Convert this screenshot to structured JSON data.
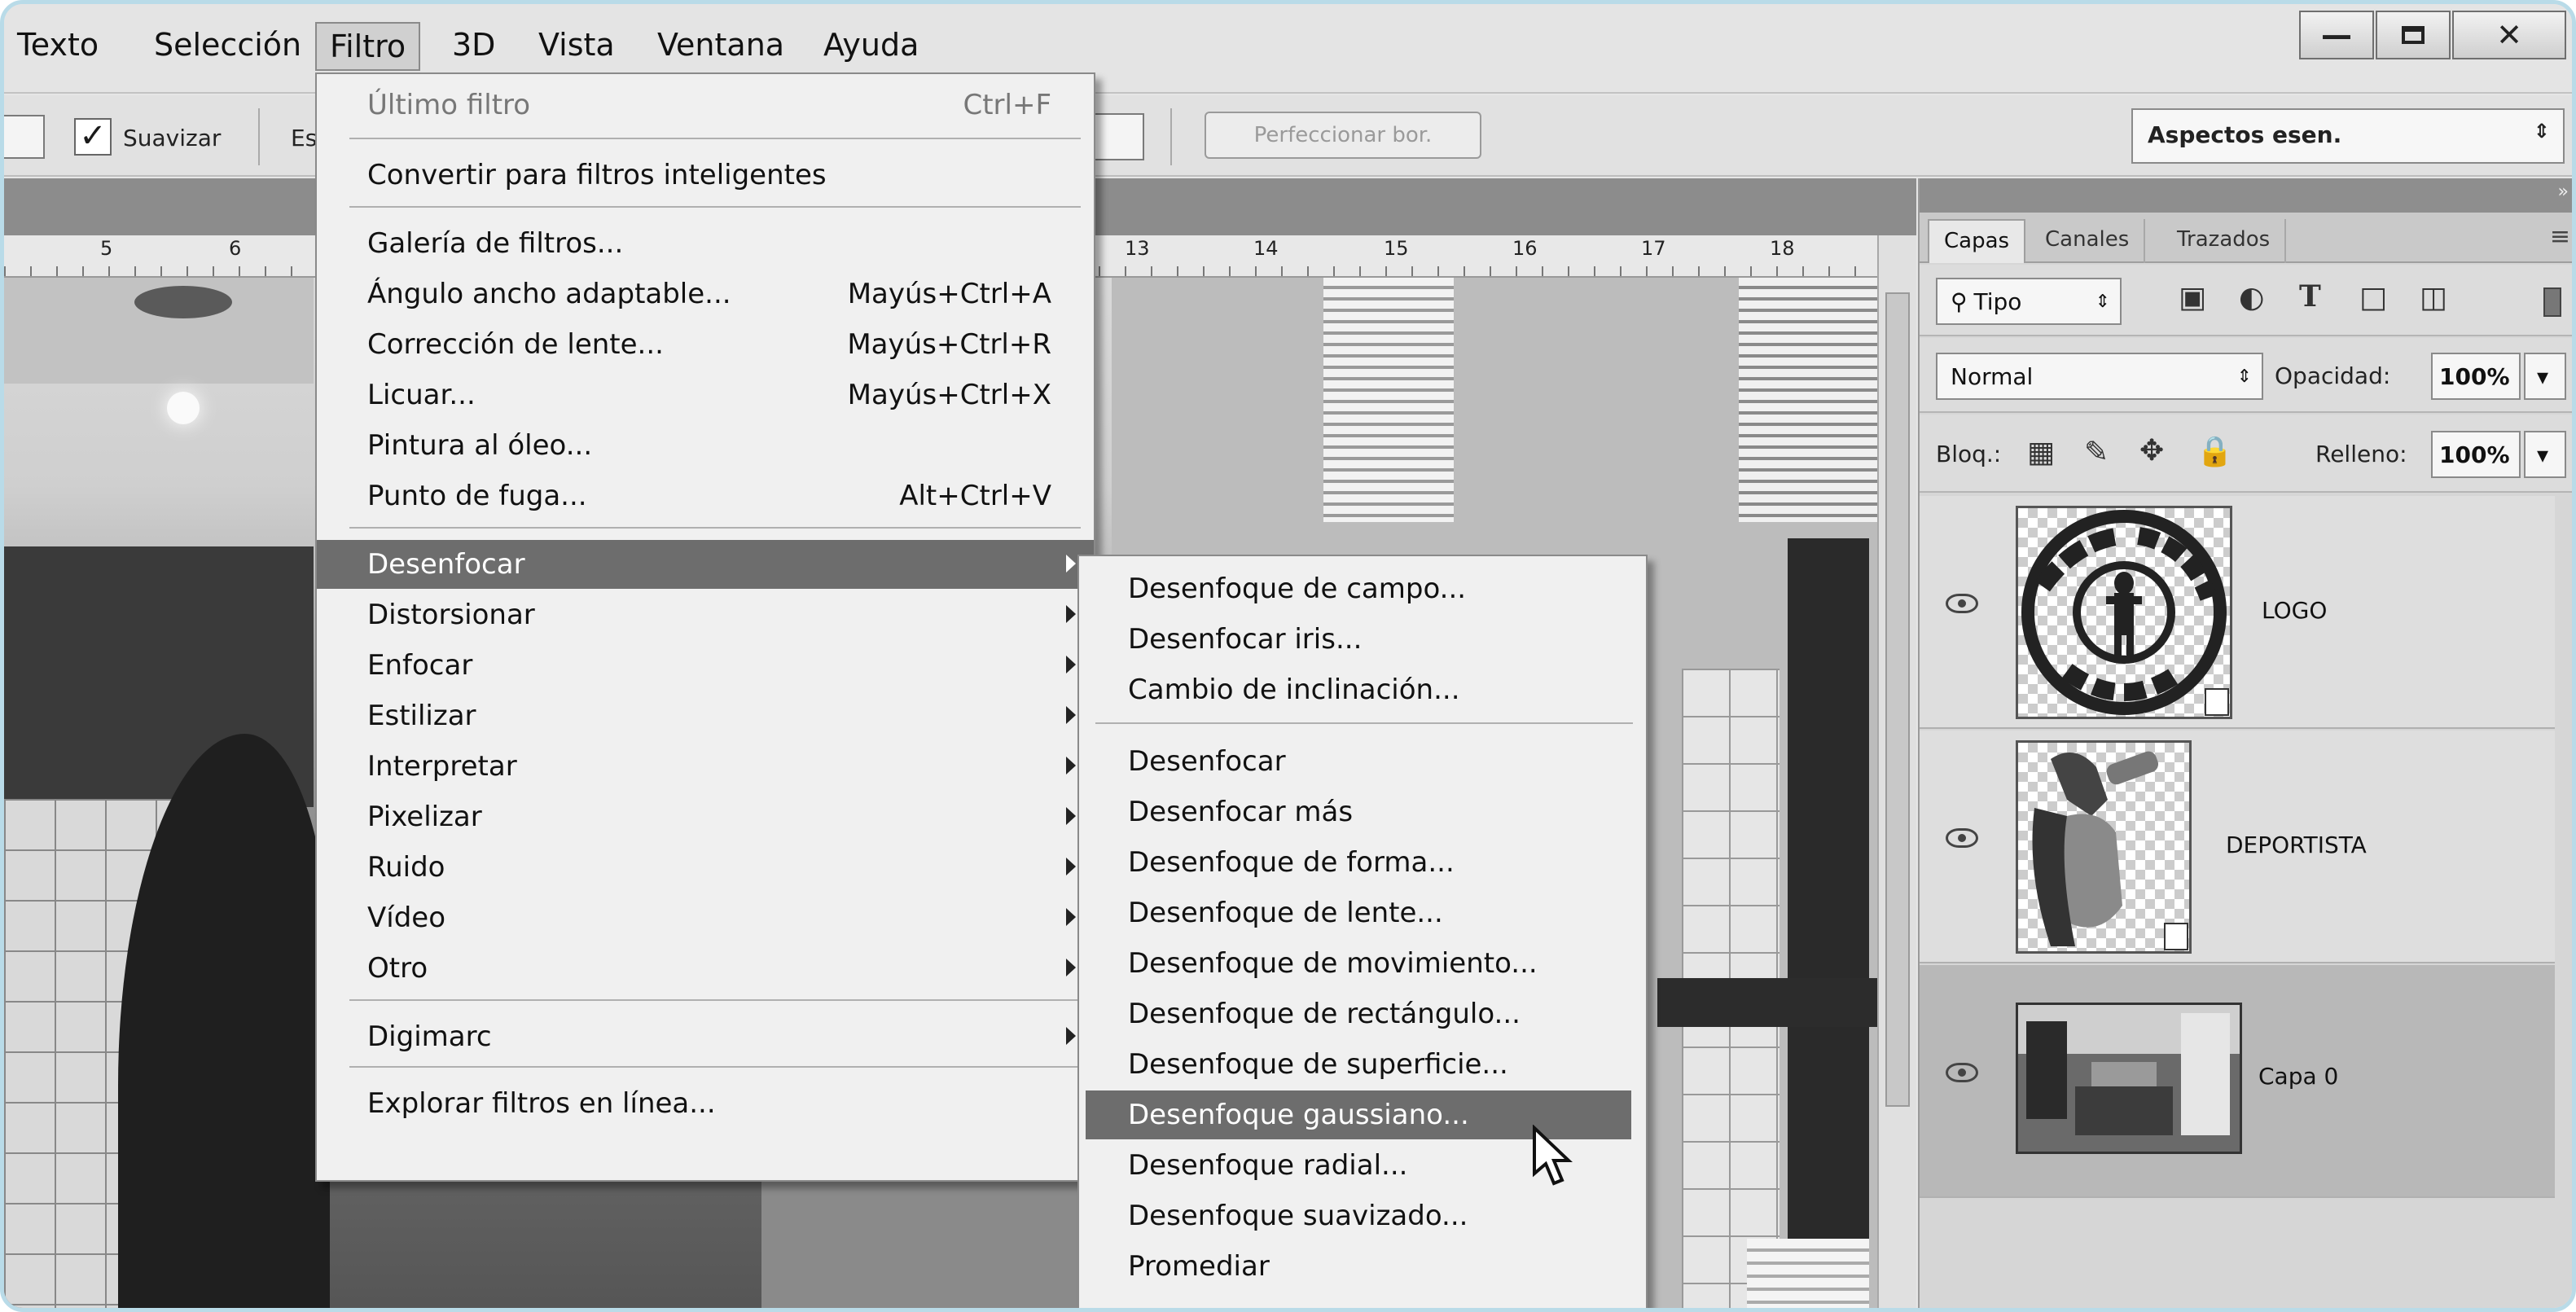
{
  "menubar": {
    "items": [
      "Texto",
      "Selección",
      "Filtro",
      "3D",
      "Vista",
      "Ventana",
      "Ayuda"
    ],
    "active": "Filtro",
    "window_buttons": [
      "minimize",
      "maximize",
      "close"
    ]
  },
  "options_bar": {
    "smooth_checked": true,
    "smooth_label": "Suavizar",
    "partial_label": "Es",
    "refine_edge_label": "Perfeccionar bor.",
    "workspace_select": "Aspectos esen."
  },
  "ruler": {
    "numbers": [
      "5",
      "6",
      "13",
      "14",
      "15",
      "16",
      "17",
      "18"
    ]
  },
  "filter_menu": {
    "items": [
      {
        "label": "Último filtro",
        "shortcut": "Ctrl+F",
        "disabled": true
      },
      {
        "label": "Convertir para filtros inteligentes",
        "shortcut": ""
      },
      {
        "label": "Galería de filtros...",
        "shortcut": ""
      },
      {
        "label": "Ángulo ancho adaptable...",
        "shortcut": "Mayús+Ctrl+A"
      },
      {
        "label": "Corrección de lente...",
        "shortcut": "Mayús+Ctrl+R"
      },
      {
        "label": "Licuar...",
        "shortcut": "Mayús+Ctrl+X"
      },
      {
        "label": "Pintura al óleo...",
        "shortcut": ""
      },
      {
        "label": "Punto de fuga...",
        "shortcut": "Alt+Ctrl+V"
      },
      {
        "label": "Desenfocar",
        "submenu": true,
        "highlighted": true
      },
      {
        "label": "Distorsionar",
        "submenu": true
      },
      {
        "label": "Enfocar",
        "submenu": true
      },
      {
        "label": "Estilizar",
        "submenu": true
      },
      {
        "label": "Interpretar",
        "submenu": true
      },
      {
        "label": "Pixelizar",
        "submenu": true
      },
      {
        "label": "Ruido",
        "submenu": true
      },
      {
        "label": "Vídeo",
        "submenu": true
      },
      {
        "label": "Otro",
        "submenu": true
      },
      {
        "label": "Digimarc",
        "submenu": true
      },
      {
        "label": "Explorar filtros en línea..."
      }
    ]
  },
  "blur_submenu": {
    "items": [
      {
        "label": "Desenfoque de campo..."
      },
      {
        "label": "Desenfocar iris..."
      },
      {
        "label": "Cambio de inclinación..."
      },
      {
        "label": "Desenfocar"
      },
      {
        "label": "Desenfocar más"
      },
      {
        "label": "Desenfoque de forma..."
      },
      {
        "label": "Desenfoque de lente..."
      },
      {
        "label": "Desenfoque de movimiento..."
      },
      {
        "label": "Desenfoque de rectángulo..."
      },
      {
        "label": "Desenfoque de superficie..."
      },
      {
        "label": "Desenfoque gaussiano...",
        "highlighted": true
      },
      {
        "label": "Desenfoque radial..."
      },
      {
        "label": "Desenfoque suavizado..."
      },
      {
        "label": "Promediar"
      }
    ]
  },
  "layers_panel": {
    "tabs": [
      "Capas",
      "Canales",
      "Trazados"
    ],
    "active_tab": "Capas",
    "filter_type": "Tipo",
    "blend_mode": "Normal",
    "opacity_label": "Opacidad:",
    "opacity_value": "100%",
    "lock_label": "Bloq.:",
    "fill_label": "Relleno:",
    "fill_value": "100%",
    "layers": [
      {
        "name": "LOGO",
        "visible": true,
        "smart_object": true,
        "selected": false
      },
      {
        "name": "DEPORTISTA",
        "visible": true,
        "smart_object": true,
        "selected": false
      },
      {
        "name": "Capa 0",
        "visible": true,
        "smart_object": false,
        "selected": true
      }
    ]
  },
  "colors": {
    "menu_highlight": "#6d6d6d",
    "frame_border": "#b9dbe8"
  }
}
